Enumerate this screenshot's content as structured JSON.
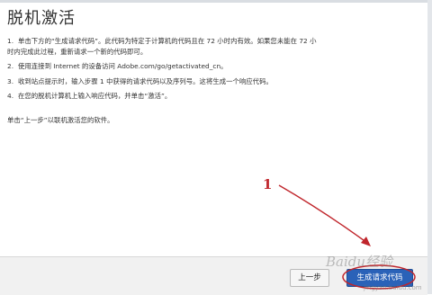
{
  "dialog": {
    "title": "脱机激活",
    "steps": [
      {
        "number": "1.",
        "line1": "单击下方的“生成请求代码”。此代码为特定于计算机的代码且在 72 小时内有效。如果您未能在 72 小",
        "line2": "时内完成此过程，重新请求一个新的代码即可。"
      },
      {
        "number": "2.",
        "line1": "使用连接到 Internet 的设备访问 Adobe.com/go/getactivated_cn。",
        "line2": ""
      },
      {
        "number": "3.",
        "line1": "收到站点提示时，输入步骤 1 中获得的请求代码以及序列号。这将生成一个响应代码。",
        "line2": ""
      },
      {
        "number": "4.",
        "line1": "在您的脱机计算机上输入响应代码，并单击“激活”。",
        "line2": ""
      }
    ],
    "closing": "单击“上一步”以联机激活您的软件。"
  },
  "footer": {
    "back_label": "上一步",
    "generate_label": "生成请求代码"
  },
  "annotation": {
    "number": "1",
    "color": "#c0262c"
  },
  "watermark": {
    "text": "Baidu经验",
    "sub": "jingyan.baidu.com"
  }
}
